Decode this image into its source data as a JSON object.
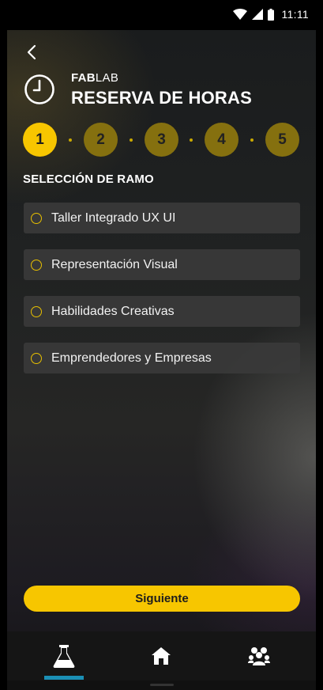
{
  "status_bar": {
    "time": "11:11",
    "icons": [
      "wifi-icon",
      "signal-icon",
      "battery-icon"
    ]
  },
  "header": {
    "brand_bold": "FAB",
    "brand_light": "LAB",
    "title": "RESERVA DE HORAS",
    "icon": "clock-icon"
  },
  "steps": [
    {
      "label": "1",
      "active": true
    },
    {
      "label": "2",
      "active": false
    },
    {
      "label": "3",
      "active": false
    },
    {
      "label": "4",
      "active": false
    },
    {
      "label": "5",
      "active": false
    }
  ],
  "section": {
    "title": "SELECCIÓN DE RAMO"
  },
  "options": [
    {
      "label": "Taller Integrado UX UI",
      "selected": false
    },
    {
      "label": "Representación Visual",
      "selected": false
    },
    {
      "label": "Habilidades Creativas",
      "selected": false
    },
    {
      "label": "Emprendedores y Empresas",
      "selected": false
    }
  ],
  "actions": {
    "next_label": "Siguiente"
  },
  "bottom_nav": {
    "items": [
      {
        "icon": "flask-icon",
        "active": true
      },
      {
        "icon": "home-icon",
        "active": false
      },
      {
        "icon": "community-icon",
        "active": false
      }
    ]
  },
  "colors": {
    "accent": "#f7c600",
    "step_inactive": "#85700f",
    "nav_indicator": "#1b8fb5"
  }
}
